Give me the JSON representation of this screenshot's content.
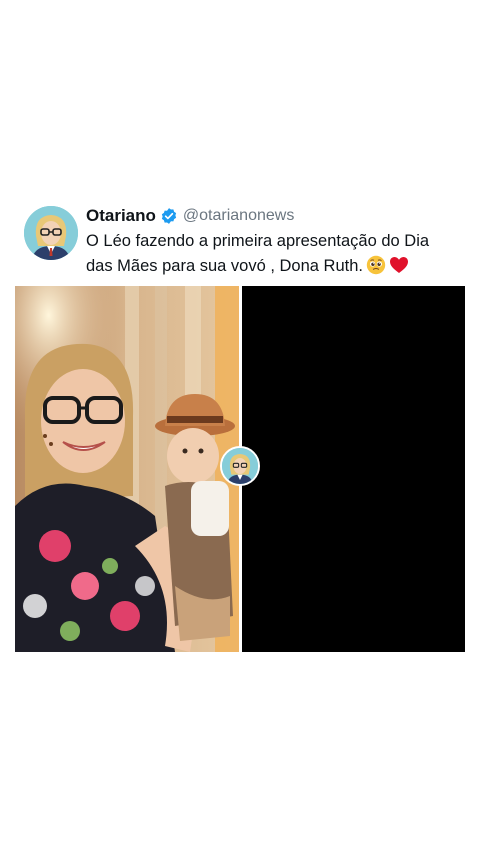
{
  "tweet": {
    "display_name": "Otariano",
    "handle": "@otarianonews",
    "text_line1": "O Léo fazendo a primeira apresentação do Dia",
    "text_line2": "das Mães para sua vovó , Dona Ruth.",
    "emojis": [
      "pleading-face-emoji",
      "red-heart-emoji"
    ]
  },
  "icons": {
    "verified": "verified-badge-icon",
    "avatar": "profile-avatar"
  },
  "colors": {
    "verified_blue": "#1d9bf0",
    "text": "#0f1419",
    "handle": "#6b7680",
    "background": "#ffffff",
    "right_panel": "#000000"
  }
}
